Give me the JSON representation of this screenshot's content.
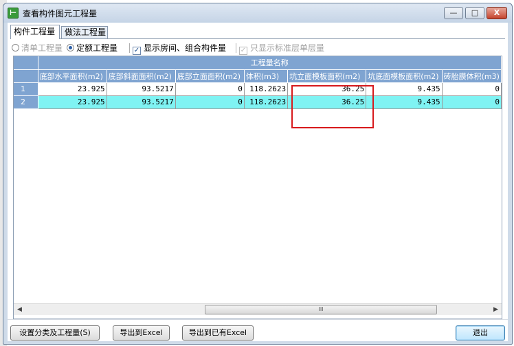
{
  "window": {
    "title": "查看构件图元工程量",
    "controls": {
      "minimize": "—",
      "maximize": "□",
      "close": "X"
    }
  },
  "tabs": [
    {
      "label": "构件工程量",
      "active": true
    },
    {
      "label": "做法工程量",
      "active": false
    }
  ],
  "options": {
    "radio_bill": {
      "label": "清单工程量",
      "checked": false,
      "disabled": true
    },
    "radio_quota": {
      "label": "定额工程量",
      "checked": true,
      "disabled": false
    },
    "show_rooms": {
      "label": "显示房间、组合构件量",
      "checked": true,
      "disabled": false
    },
    "standard_floor": {
      "label": "只显示标准层单层量",
      "checked": true,
      "disabled": true
    }
  },
  "grid": {
    "group_header": "工程量名称",
    "columns": [
      "底部水平面积(m2)",
      "底部斜面面积(m2)",
      "底部立面面积(m2)",
      "体积(m3)",
      "坑立面模板面积(m2)",
      "坑底面模板面积(m2)",
      "砖胎膜体积(m3)"
    ],
    "rows": [
      {
        "num": "1",
        "values": [
          "23.925",
          "93.5217",
          "0",
          "118.2623",
          "36.25",
          "9.435",
          "0"
        ]
      },
      {
        "num": "2",
        "values": [
          "23.925",
          "93.5217",
          "0",
          "118.2623",
          "36.25",
          "9.435",
          "0"
        ]
      }
    ]
  },
  "scrollbar": {
    "left_arrow": "◀",
    "right_arrow": "▶",
    "grip": "III"
  },
  "buttons": {
    "classify": "设置分类及工程量(S)",
    "export_excel": "导出到Excel",
    "export_existing_excel": "导出到已有Excel",
    "exit": "退出"
  },
  "colors": {
    "header_bg": "#7fa4d1",
    "selected_row": "#7ff3f3",
    "highlight": "#d7191c"
  }
}
